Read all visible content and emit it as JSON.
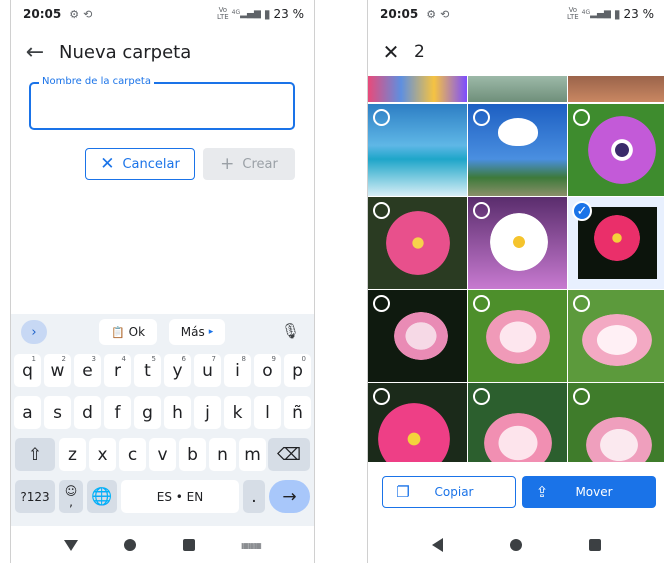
{
  "left_screen": {
    "status": {
      "time": "20:05",
      "settings_icon": "gear-icon",
      "sync_icon": "sync-icon",
      "lte_top": "Vo",
      "lte_bottom": "LTE",
      "network": "4G",
      "battery": "23 %"
    },
    "header": {
      "back_icon": "arrow-left-icon",
      "title": "Nueva carpeta"
    },
    "folder_name_field": {
      "label": "Nombre de la carpeta",
      "value": ""
    },
    "buttons": {
      "cancel": "Cancelar",
      "create": "Crear"
    },
    "keyboard": {
      "suggestions": {
        "ok_chip": "Ok",
        "more_chip": "Más"
      },
      "row1": [
        {
          "k": "q",
          "h": "1"
        },
        {
          "k": "w",
          "h": "2"
        },
        {
          "k": "e",
          "h": "3"
        },
        {
          "k": "r",
          "h": "4"
        },
        {
          "k": "t",
          "h": "5"
        },
        {
          "k": "y",
          "h": "6"
        },
        {
          "k": "u",
          "h": "7"
        },
        {
          "k": "i",
          "h": "8"
        },
        {
          "k": "o",
          "h": "9"
        },
        {
          "k": "p",
          "h": "0"
        }
      ],
      "row2": [
        "a",
        "s",
        "d",
        "f",
        "g",
        "h",
        "j",
        "k",
        "l",
        "ñ"
      ],
      "row3": [
        "z",
        "x",
        "c",
        "v",
        "b",
        "n",
        "m"
      ],
      "row4": {
        "symbols": "?123",
        "emoji_top": "☺",
        "emoji_bottom": ",",
        "language": "ES • EN",
        "period": "."
      }
    },
    "navbar": {
      "back": "nav-back-icon",
      "home": "nav-home-icon",
      "recents": "nav-recents-icon",
      "keyboard": "keyboard-icon"
    }
  },
  "right_screen": {
    "status": {
      "time": "20:05",
      "lte_top": "Vo",
      "lte_bottom": "LTE",
      "network": "4G",
      "battery": "23 %"
    },
    "selection_bar": {
      "close_icon": "close-icon",
      "count": "2"
    },
    "photos_selected_index": 5,
    "footer": {
      "copy": "Copiar",
      "move": "Mover"
    },
    "colors": {
      "accent": "#1a73e8"
    }
  }
}
